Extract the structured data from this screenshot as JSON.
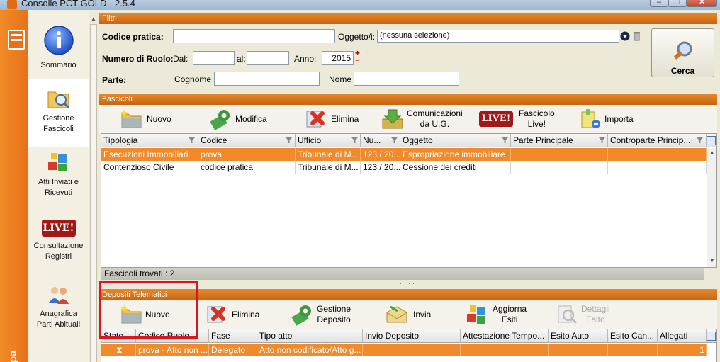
{
  "window": {
    "title": "Consolle PCT GOLD - 2.5.4",
    "min_symbol": "–",
    "max_symbol": "□",
    "close_symbol": "✕"
  },
  "leftbar": {
    "vertical_text": "Spa"
  },
  "nav": {
    "items": [
      {
        "label_line1": "Sommario",
        "label_line2": "",
        "icon": "info-icon"
      },
      {
        "label_line1": "Gestione",
        "label_line2": "Fascicoli",
        "icon": "folder-search-icon"
      },
      {
        "label_line1": "Atti Inviati e",
        "label_line2": "Ricevuti",
        "icon": "blocks-icon"
      },
      {
        "label_line1": "Consultazione",
        "label_line2": "Registri",
        "icon": "live-badge-icon",
        "badge": "LIVE!"
      },
      {
        "label_line1": "Anagrafica",
        "label_line2": "Parti Abituali",
        "icon": "people-icon"
      }
    ]
  },
  "filters": {
    "header": "Filtri",
    "codice_label": "Codice pratica:",
    "codice_value": "",
    "oggetto_label": "Oggetto/i:",
    "oggetto_value": "(nessuna selezione)",
    "ruolo_label": "Numero di Ruolo:",
    "dal_label": "Dal:",
    "dal_value": "",
    "al_label": "al:",
    "al_value": "",
    "anno_label": "Anno:",
    "anno_value": "2015",
    "parte_label": "Parte:",
    "cognome_label": "Cognome",
    "cognome_value": "",
    "nome_label": "Nome",
    "nome_value": "",
    "search_button": "Cerca"
  },
  "fascicoli": {
    "header": "Fascicoli",
    "toolbar": [
      {
        "label": "Nuovo",
        "label2": "",
        "icon": "new-folder-icon"
      },
      {
        "label": "Modifica",
        "label2": "",
        "icon": "edit-icon"
      },
      {
        "label": "Elimina",
        "label2": "",
        "icon": "delete-icon"
      },
      {
        "label": "Comunicazioni",
        "label2": "da U.G.",
        "icon": "inbox-icon"
      },
      {
        "label": "Fascicolo",
        "label2": "Live!",
        "icon": "live-badge-icon",
        "badge": "LIVE!"
      },
      {
        "label": "Importa",
        "label2": "",
        "icon": "import-icon"
      }
    ],
    "columns": [
      "Tipologia",
      "Codice",
      "Ufficio",
      "Nu...",
      "Oggetto",
      "Parte Principale",
      "Controparte Princip..."
    ],
    "rows": [
      [
        "Esecuzioni Immobiliari",
        "prova",
        "Tribunale di M...",
        "123 / 20...",
        "Espropriazione immobiliare",
        "",
        ""
      ],
      [
        "Contenzioso Civile",
        "codice pratica",
        "Tribunale di M...",
        "123 / 20...",
        "Cessione dei crediti",
        "",
        ""
      ]
    ],
    "found_label": "Fascicoli trovati :",
    "found_count": "2"
  },
  "depositi": {
    "header": "Depositi Telematici",
    "toolbar": [
      {
        "label": "Nuovo",
        "label2": "",
        "icon": "new-folder-icon",
        "enabled": true
      },
      {
        "label": "Elimina",
        "label2": "",
        "icon": "delete-icon",
        "enabled": true
      },
      {
        "label": "Gestione",
        "label2": "Deposito",
        "icon": "edit-icon",
        "enabled": true
      },
      {
        "label": "Invia",
        "label2": "",
        "icon": "send-envelope-icon",
        "enabled": true
      },
      {
        "label": "Aggiorna",
        "label2": "Esiti",
        "icon": "refresh-blocks-icon",
        "enabled": true
      },
      {
        "label": "Dettagli",
        "label2": "Esito",
        "icon": "magnifier-doc-icon",
        "enabled": false
      }
    ],
    "columns": [
      "Stato",
      "Codice Ruolo",
      "Fase",
      "Tipo atto",
      "Invio Deposito",
      "Attestazione Tempo...",
      "Esito Auto",
      "Esito Can...",
      "Allegati"
    ],
    "rows": [
      [
        "⧗",
        "prova - Atto non ...",
        "Delegato",
        "Atto non codificato/Atto g...",
        "",
        "",
        "",
        "",
        "1"
      ]
    ]
  },
  "colors": {
    "accent_orange": "#e8701a",
    "header_orange": "#d07318",
    "selected_row": "#f08a2a",
    "highlight_box": "#d9151d"
  }
}
